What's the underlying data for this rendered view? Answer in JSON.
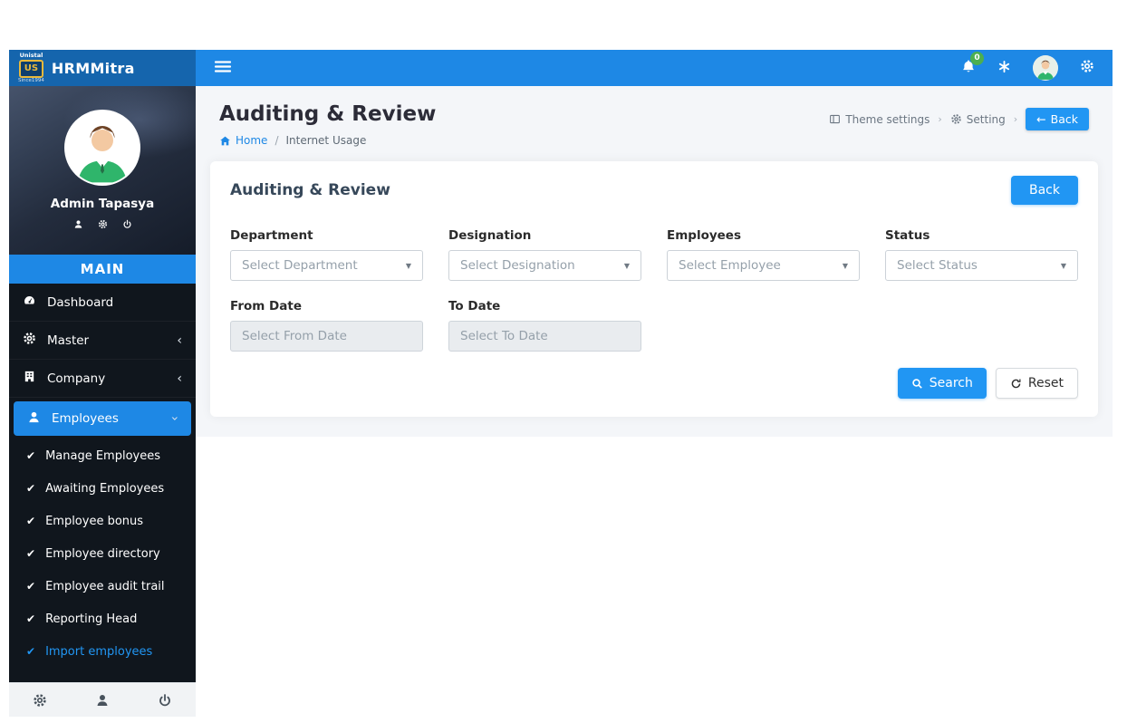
{
  "app": {
    "brand": "HRMMitra",
    "logo_top": "Unistal",
    "logo_mark": "US",
    "logo_bottom": "Since1994"
  },
  "topbar": {
    "notification_badge": "0"
  },
  "sidebar": {
    "profile_name": "Admin Tapasya",
    "section_title": "MAIN",
    "menu": [
      {
        "label": "Dashboard"
      },
      {
        "label": "Master"
      },
      {
        "label": "Company"
      },
      {
        "label": "Employees"
      }
    ],
    "submenu": [
      {
        "label": "Manage Employees"
      },
      {
        "label": "Awaiting Employees"
      },
      {
        "label": "Employee bonus"
      },
      {
        "label": "Employee directory"
      },
      {
        "label": "Employee audit trail"
      },
      {
        "label": "Reporting Head"
      },
      {
        "label": "Import employees"
      }
    ]
  },
  "page": {
    "title": "Auditing & Review",
    "breadcrumb_home": "Home",
    "breadcrumb_separator": "/",
    "breadcrumb_current": "Internet Usage",
    "theme_settings_label": "Theme settings",
    "setting_label": "Setting",
    "back_label": "Back"
  },
  "card": {
    "title": "Auditing & Review",
    "back_label": "Back",
    "fields": [
      {
        "label": "Department",
        "placeholder": "Select Department"
      },
      {
        "label": "Designation",
        "placeholder": "Select Designation"
      },
      {
        "label": "Employees",
        "placeholder": "Select Employee"
      },
      {
        "label": "Status",
        "placeholder": "Select Status"
      }
    ],
    "dates": [
      {
        "label": "From Date",
        "placeholder": "Select From Date"
      },
      {
        "label": "To Date",
        "placeholder": "Select To Date"
      }
    ],
    "search_label": "Search",
    "reset_label": "Reset"
  },
  "icons": {
    "check": "✔",
    "caret_down": "▼",
    "chevron_collapsed": "‹",
    "meta_separator": "›",
    "back_arrow": "←"
  },
  "colors": {
    "navbar_blue": "#1e88e5",
    "button_blue": "#2196f3",
    "sidebar_dark": "#10161d",
    "badge_green": "#4caf50",
    "content_bg": "#f4f6f9"
  }
}
